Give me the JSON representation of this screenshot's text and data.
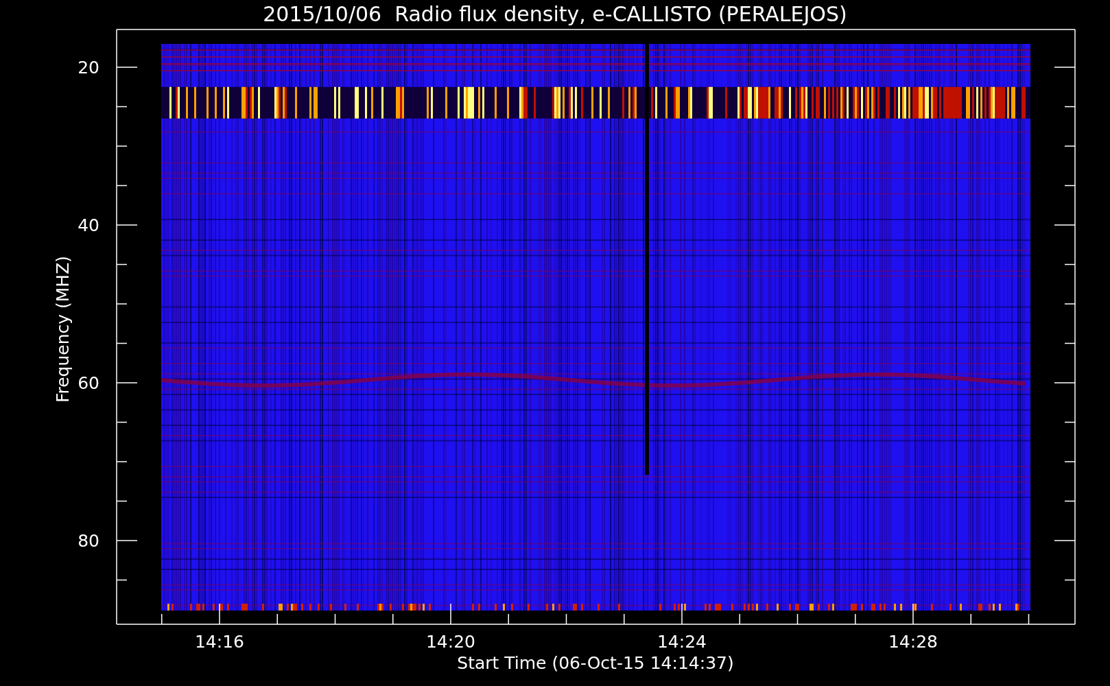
{
  "title": "2015/10/06  Radio flux density, e-CALLISTO (PERALEJOS)",
  "y_axis": {
    "label": "Frequency (MHZ)",
    "ticks": [
      "20",
      "40",
      "60",
      "80"
    ]
  },
  "x_axis": {
    "label": "Start Time (06-Oct-15 14:14:37)",
    "ticks": [
      "14:16",
      "14:20",
      "14:24",
      "14:28"
    ]
  }
}
